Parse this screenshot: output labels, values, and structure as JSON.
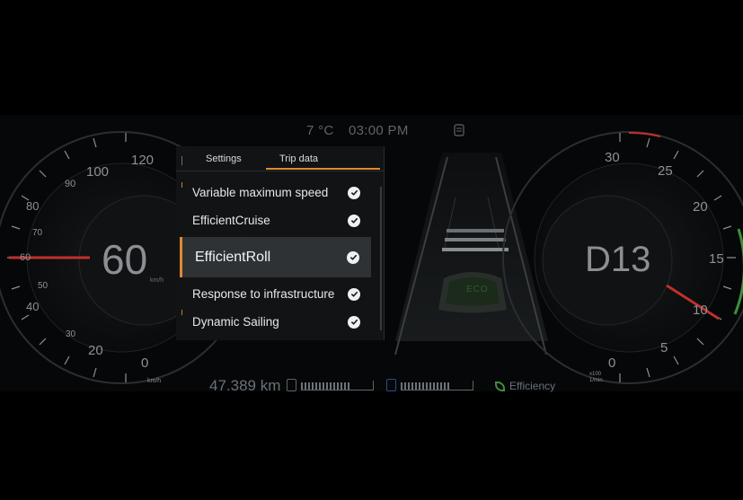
{
  "status": {
    "temperature": "7 °C",
    "time": "03:00 PM",
    "status_icon": "fuel-filter-icon"
  },
  "speedometer": {
    "speed": "60",
    "unit": "km/h",
    "scale_labels": [
      "0",
      "20",
      "30",
      "40",
      "50",
      "60",
      "70",
      "80",
      "90",
      "100",
      "120"
    ],
    "bottom_unit": "km/h"
  },
  "tachometer": {
    "gear": "D13",
    "scale_labels": [
      "0",
      "5",
      "10",
      "15",
      "20",
      "25",
      "30"
    ],
    "multiplier": "x100",
    "rpm_unit": "1/min"
  },
  "bottom_bar": {
    "odometer": "47.389 km",
    "fuel_icon": "fuel-pump-icon",
    "adblue_icon": "adblue-icon",
    "efficiency_label": "Efficiency",
    "efficiency_icon": "leaf-icon"
  },
  "road": {
    "eco_label": "ECO"
  },
  "menu": {
    "tabs": [
      {
        "label": "Settings",
        "active": false
      },
      {
        "label": "Trip data",
        "active": true
      }
    ],
    "items": [
      {
        "label": "Variable maximum speed",
        "checked": true
      },
      {
        "label": "EfficientCruise",
        "checked": true
      },
      {
        "label": "EfficientRoll",
        "checked": true,
        "selected": true
      },
      {
        "label": "Response to infrastructure",
        "checked": true
      },
      {
        "label": "Dynamic Sailing",
        "checked": true
      }
    ]
  },
  "colors": {
    "accent": "#e08a2c",
    "redline": "#c0302a",
    "eco_green": "#3e8f3a",
    "background": "#000000"
  }
}
